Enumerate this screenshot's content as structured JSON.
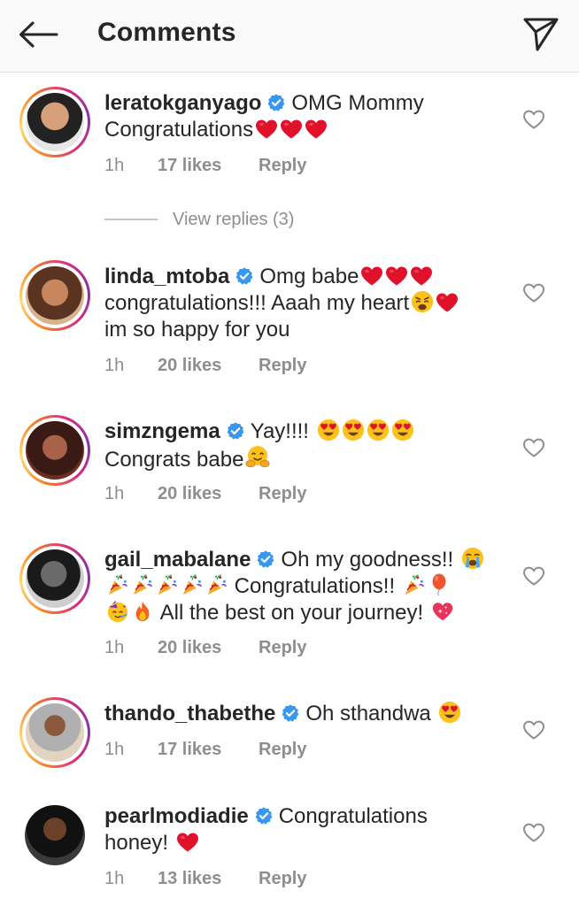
{
  "header": {
    "title": "Comments"
  },
  "comments": [
    {
      "username": "leratokganyago",
      "text": "OMG Mommy Congratulations",
      "time": "1h",
      "likes": "17 likes",
      "reply": "Reply",
      "view_replies": "View replies (3)"
    },
    {
      "username": "linda_mtoba",
      "text1": "Omg babe",
      "text2": "congratulations!!! Aaah my heart",
      "text3": "im so happy for you",
      "time": "1h",
      "likes": "20 likes",
      "reply": "Reply"
    },
    {
      "username": "simzngema",
      "text1": "Yay!!!!",
      "text2": "Congrats babe",
      "time": "1h",
      "likes": "20 likes",
      "reply": "Reply"
    },
    {
      "username": "gail_mabalane",
      "text1": "Oh my goodness!!",
      "text2": "Congratulations!!",
      "text3": "All the best on your journey!",
      "time": "1h",
      "likes": "20 likes",
      "reply": "Reply"
    },
    {
      "username": "thando_thabethe",
      "text": "Oh sthandwa",
      "time": "1h",
      "likes": "17 likes",
      "reply": "Reply"
    },
    {
      "username": "pearlmodiadie",
      "text1": "Congratulations",
      "text2": "honey!",
      "time": "1h",
      "likes": "13 likes",
      "reply": "Reply"
    }
  ],
  "colors": {
    "verified": "#3897f0",
    "meta": "#8e8e8e",
    "text": "#262626",
    "heart_emoji": "#e0112b"
  },
  "icons": [
    "back-arrow-icon",
    "direct-share-icon",
    "verified-badge-icon",
    "heart-outline-icon"
  ]
}
